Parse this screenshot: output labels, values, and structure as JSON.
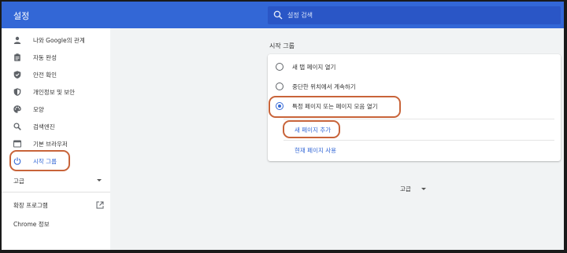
{
  "header": {
    "title": "설정",
    "search_placeholder": "설정 검색"
  },
  "sidebar": {
    "items": [
      {
        "label": "나와 Google의 관계",
        "icon": "person-icon"
      },
      {
        "label": "자동 완성",
        "icon": "clipboard-icon"
      },
      {
        "label": "안전 확인",
        "icon": "shield-check-icon"
      },
      {
        "label": "개인정보 및 보안",
        "icon": "shield-icon"
      },
      {
        "label": "모양",
        "icon": "palette-icon"
      },
      {
        "label": "검색엔진",
        "icon": "search-icon"
      },
      {
        "label": "기본 브라우저",
        "icon": "browser-window-icon"
      },
      {
        "label": "시작 그룹",
        "icon": "power-icon",
        "active": true
      }
    ],
    "advanced_label": "고급",
    "extensions_label": "확장 프로그램",
    "about_label": "Chrome 정보"
  },
  "main": {
    "section_title": "시작 그룹",
    "options": [
      {
        "label": "새 탭 페이지 열기",
        "selected": false
      },
      {
        "label": "중단한 위치에서 계속하기",
        "selected": false
      },
      {
        "label": "특정 페이지 또는 페이지 모음 열기",
        "selected": true
      }
    ],
    "add_page_label": "새 페이지 추가",
    "use_current_label": "현재 페이지 사용",
    "advanced_label": "고급"
  },
  "colors": {
    "accent": "#3367d6",
    "annotation": "#c8643a"
  }
}
